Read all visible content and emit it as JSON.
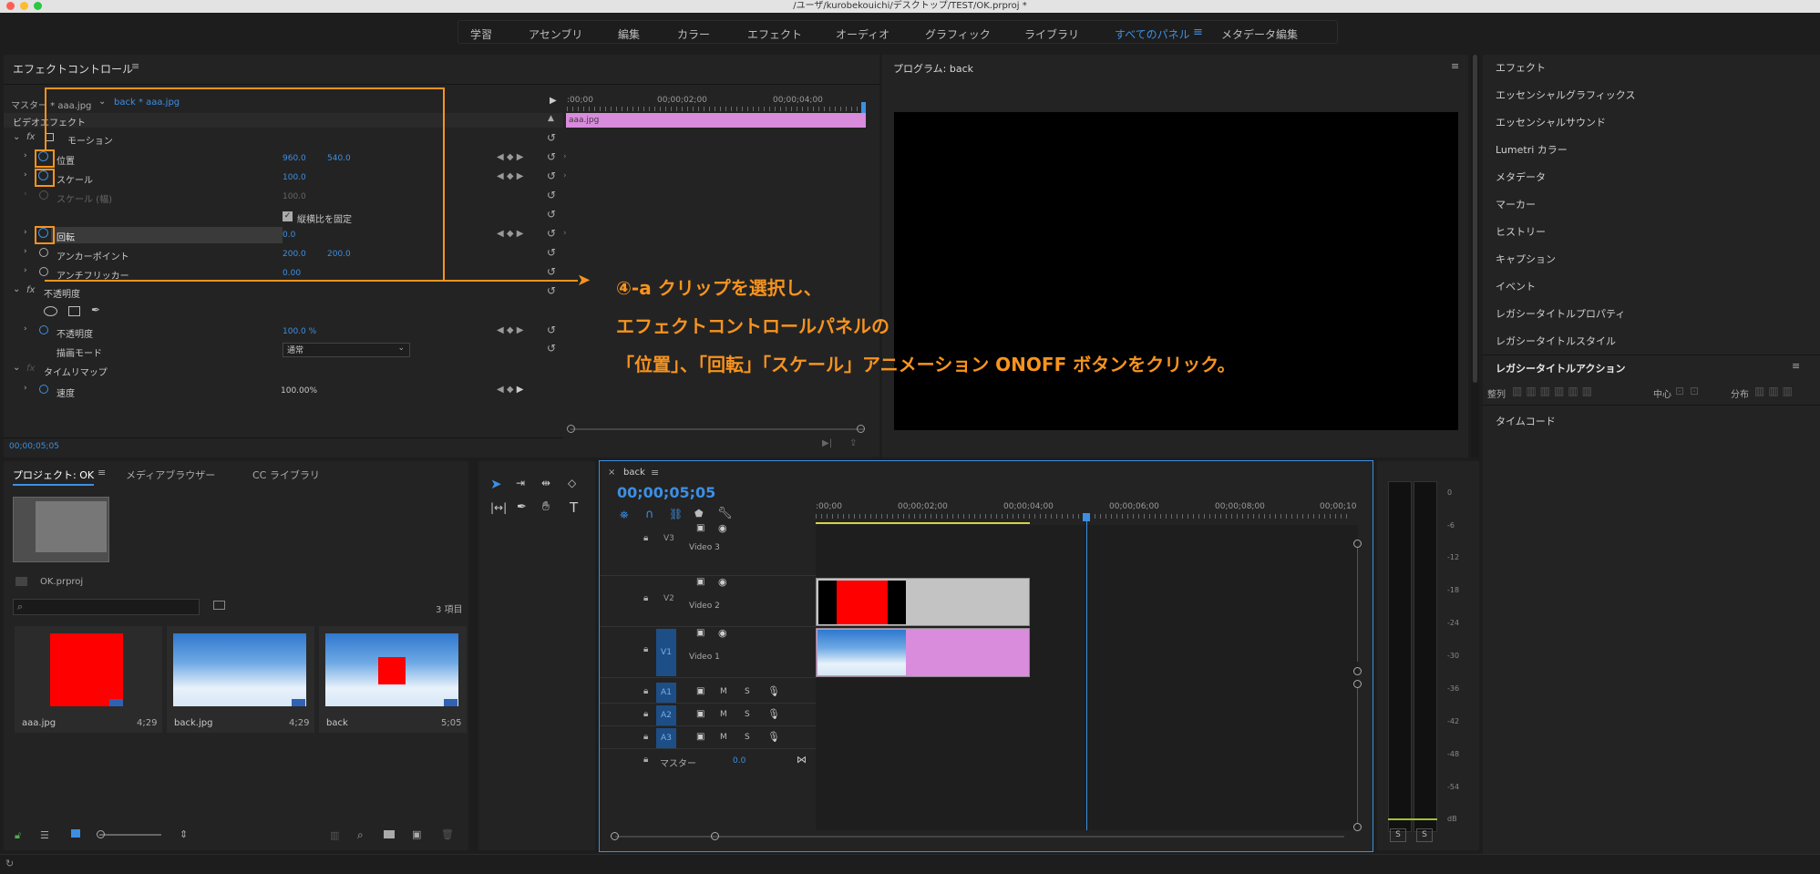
{
  "window": {
    "title": "/ユーザ/kurobekouichi/デスクトップ/TEST/OK.prproj *"
  },
  "workspaces": [
    "学習",
    "アセンブリ",
    "編集",
    "カラー",
    "エフェクト",
    "オーディオ",
    "グラフィック",
    "ライブラリ",
    "すべてのパネル",
    "メタデータ編集"
  ],
  "effect_controls": {
    "title": "エフェクトコントロール",
    "master_tab": "マスター * aaa.jpg",
    "clip_tab": "back * aaa.jpg",
    "section": "ビデオエフェクト",
    "times": [
      ":00;00",
      "00;00;02;00",
      "00;00;04;00"
    ],
    "clip_bar_label": "aaa.jpg",
    "motion_label": "モーション",
    "position": {
      "label": "位置",
      "x": "960.0",
      "y": "540.0"
    },
    "scale": {
      "label": "スケール",
      "value": "100.0"
    },
    "scale_width": {
      "label": "スケール (幅)",
      "value": "100.0"
    },
    "uniform_scale": "縦横比を固定",
    "rotation": {
      "label": "回転",
      "value": "0.0"
    },
    "anchor": {
      "label": "アンカーポイント",
      "x": "200.0",
      "y": "200.0"
    },
    "antiflicker": {
      "label": "アンチフリッカー",
      "value": "0.00"
    },
    "opacity_section": "不透明度",
    "opacity": {
      "label": "不透明度",
      "value": "100.0 %"
    },
    "blend_mode": {
      "label": "描画モード",
      "value": "通常"
    },
    "time_remap": "タイムリマップ",
    "speed": {
      "label": "速度",
      "value": "100.00%"
    },
    "current_time": "00;00;05;05"
  },
  "annotation": {
    "line1": "④-a クリップを選択し、",
    "line2": "エフェクトコントロールパネルの",
    "line3": "「位置」、「回転」「スケール」アニメーション ONOFF ボタンをクリック。"
  },
  "program": {
    "title": "プログラム: back"
  },
  "right_panel": {
    "items": [
      "エフェクト",
      "エッセンシャルグラフィックス",
      "エッセンシャルサウンド",
      "Lumetri カラー",
      "メタデータ",
      "マーカー",
      "ヒストリー",
      "キャプション",
      "イベント",
      "レガシータイトルプロパティ",
      "レガシータイトルスタイル"
    ],
    "legacy_actions": "レガシータイトルアクション",
    "align_label": "整列",
    "center_label": "中心",
    "distribute_label": "分布",
    "timecode": "タイムコード"
  },
  "project": {
    "tabs": [
      "プロジェクト: OK",
      "メディアブラウザー",
      "CC ライブラリ"
    ],
    "file": "OK.prproj",
    "count": "3 項目",
    "items": [
      {
        "name": "aaa.jpg",
        "duration": "4;29",
        "color": "#ff0000"
      },
      {
        "name": "back.jpg",
        "duration": "4;29"
      },
      {
        "name": "back",
        "duration": "5;05"
      }
    ]
  },
  "timeline": {
    "sequence": "back",
    "timecode": "00;00;05;05",
    "ruler": [
      ":00;00",
      "00;00;02;00",
      "00;00;04;00",
      "00;00;06;00",
      "00;00;08;00",
      "00;00;10"
    ],
    "video_tracks": [
      {
        "id": "V3",
        "name": "Video 3"
      },
      {
        "id": "V2",
        "name": "Video 2"
      },
      {
        "id": "V1",
        "name": "Video 1"
      }
    ],
    "audio_tracks": [
      "A1",
      "A2",
      "A3"
    ],
    "master": {
      "label": "マスター",
      "value": "0.0"
    },
    "m": "M",
    "s": "S"
  },
  "meter": {
    "scale": [
      "0",
      "-6",
      "-12",
      "-18",
      "-24",
      "-30",
      "-36",
      "-42",
      "-48",
      "-54",
      "dB"
    ],
    "solo": "S"
  },
  "colors": {
    "accent": "#3d8fe3",
    "annotation": "#f7931e",
    "clip_pink": "#d98bdc",
    "clip_gray": "#c3c3c3",
    "red": "#ff0000"
  }
}
